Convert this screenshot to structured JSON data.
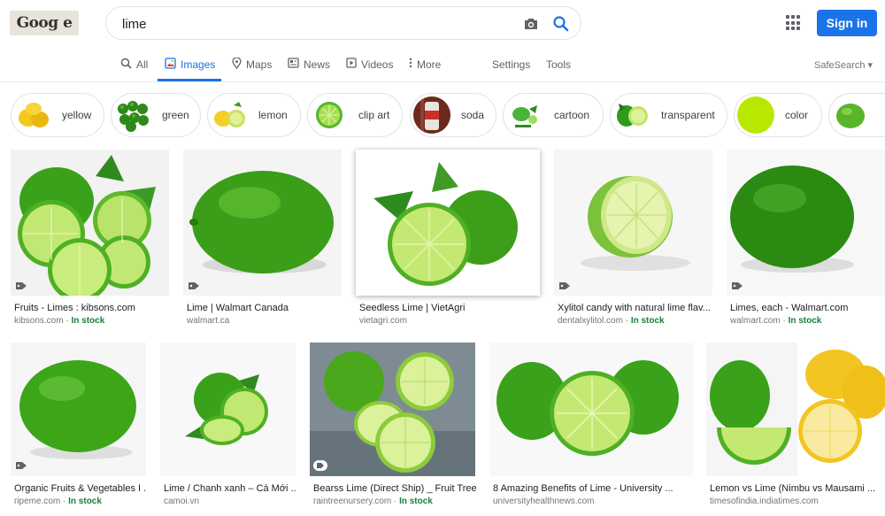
{
  "header": {
    "logo_text": "Goog  e",
    "search_value": "lime",
    "signin_label": "Sign in"
  },
  "tabs": [
    {
      "label": "All"
    },
    {
      "label": "Images"
    },
    {
      "label": "Maps"
    },
    {
      "label": "News"
    },
    {
      "label": "Videos"
    },
    {
      "label": "More"
    }
  ],
  "tools": {
    "settings": "Settings",
    "tools": "Tools",
    "safesearch": "SafeSearch ▾"
  },
  "chips": [
    {
      "label": "yellow"
    },
    {
      "label": "green"
    },
    {
      "label": "lemon"
    },
    {
      "label": "clip art"
    },
    {
      "label": "soda"
    },
    {
      "label": "cartoon"
    },
    {
      "label": "transparent"
    },
    {
      "label": "color"
    },
    {
      "label": ""
    }
  ],
  "results": [
    {
      "title": "Fruits - Limes : kibsons.com",
      "source": "kibsons.com",
      "stock": "In stock"
    },
    {
      "title": "Lime | Walmart Canada",
      "source": "walmart.ca",
      "stock": ""
    },
    {
      "title": "Seedless Lime | VietAgri",
      "source": "vietagri.com",
      "stock": ""
    },
    {
      "title": "Xylitol candy with natural lime flav...",
      "source": "dentalxylitol.com",
      "stock": "In stock"
    },
    {
      "title": "Limes, each - Walmart.com",
      "source": "walmart.com",
      "stock": "In stock"
    },
    {
      "title": "Organic Fruits & Vegetables I ...",
      "source": "ripeme.com",
      "stock": "In stock"
    },
    {
      "title": "Lime / Chanh xanh – Cá Mới ...",
      "source": "camoi.vn",
      "stock": ""
    },
    {
      "title": "Bearss Lime (Direct Ship) _ Fruit Trees",
      "source": "raintreenursery.com",
      "stock": "In stock"
    },
    {
      "title": "8 Amazing Benefits of Lime - University ...",
      "source": "universityhealthnews.com",
      "stock": ""
    },
    {
      "title": "Lemon vs Lime (Nimbu vs Mausami ...",
      "source": "timesofindia.indiatimes.com",
      "stock": ""
    }
  ],
  "colors": {
    "accent": "#1a73e8",
    "stock_green": "#188038",
    "lime_green": "#3fa61c",
    "lime_light": "#b8e36a"
  }
}
